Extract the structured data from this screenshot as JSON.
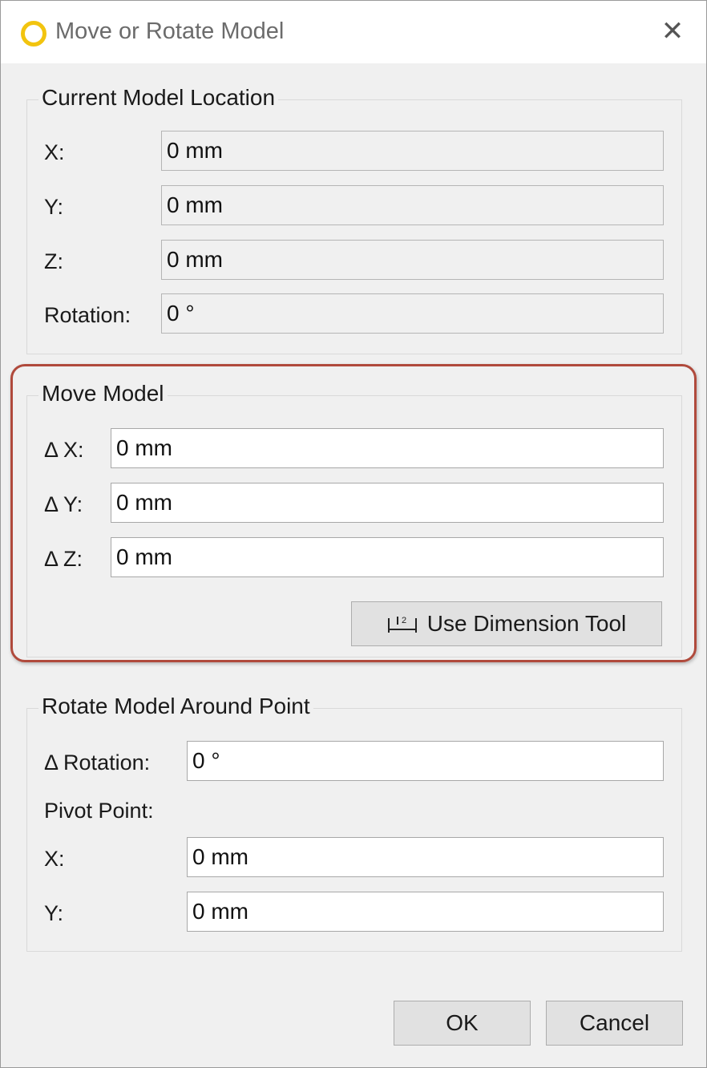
{
  "window": {
    "title": "Move or Rotate Model",
    "close_glyph": "✕",
    "icon": "circle-logo-icon",
    "accent": "#f2c40f"
  },
  "current_location": {
    "title": "Current Model Location",
    "rows": [
      {
        "label": "X:",
        "value": "0 mm"
      },
      {
        "label": "Y:",
        "value": "0 mm"
      },
      {
        "label": "Z:",
        "value": "0 mm"
      },
      {
        "label": "Rotation:",
        "value": "0 °"
      }
    ]
  },
  "move_model": {
    "title": "Move Model",
    "rows": [
      {
        "label": "Δ X:",
        "value": "0 mm"
      },
      {
        "label": "Δ Y:",
        "value": "0 mm"
      },
      {
        "label": "Δ Z:",
        "value": "0 mm"
      }
    ],
    "dimension_button": "Use Dimension Tool",
    "dimension_icon": "dimension-ruler-icon",
    "highlight_color": "#b04a3c"
  },
  "rotate_model": {
    "title": "Rotate Model Around Point",
    "rotation_label": "Δ Rotation:",
    "rotation_value": "0 °",
    "pivot_label": "Pivot Point:",
    "pivot_rows": [
      {
        "label": "X:",
        "value": "0 mm"
      },
      {
        "label": "Y:",
        "value": "0 mm"
      }
    ]
  },
  "footer": {
    "ok": "OK",
    "cancel": "Cancel"
  }
}
